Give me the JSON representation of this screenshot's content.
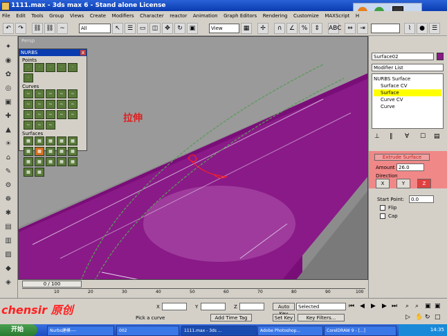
{
  "window": {
    "title": "1111.max - 3ds max 6 - Stand alone License"
  },
  "menu": [
    "File",
    "Edit",
    "Tools",
    "Group",
    "Views",
    "Create",
    "Modifiers",
    "Character",
    "reactor",
    "Animation",
    "Graph Editors",
    "Rendering",
    "Customize",
    "MAXScript",
    "H"
  ],
  "toolbar": {
    "selection_filter": "All",
    "ref_coord": "View"
  },
  "viewport": {
    "label": "Persp",
    "annotation": "拉伸"
  },
  "nurbs_panel": {
    "title": "NURBS",
    "points_label": "Points",
    "curves_label": "Curves",
    "surfaces_label": "Surfaces",
    "close": "x"
  },
  "command_panel": {
    "object_name": "Surface02",
    "modifier_list": "Modifier List",
    "stack": [
      "NURBS Surface",
      "Surface CV",
      "Surface",
      "Curve CV",
      "Curve"
    ],
    "rollout_title": "Extrude Surface",
    "amount_label": "Amount",
    "amount_value": "26.0",
    "direction_label": "Direction",
    "dir_x": "X",
    "dir_y": "Y",
    "dir_z": "Z",
    "start_point_label": "Start Point:",
    "start_point_value": "0.0",
    "flip_label": "Flip",
    "cap_label": "Cap"
  },
  "timeline": {
    "frame_display": "0 / 100",
    "ticks": [
      "10",
      "20",
      "30",
      "40",
      "50",
      "60",
      "70",
      "80",
      "90",
      "100"
    ]
  },
  "status": {
    "x_label": "X",
    "y_label": "Y",
    "z_label": "Z",
    "auto_key": "Auto Key",
    "set_key": "Set Key",
    "selected": "Selected",
    "key_filters": "Key Filters...",
    "prompt": "Pick a curve",
    "add_time_tag": "Add Time Tag",
    "watermark": "chensir 原创"
  },
  "taskbar": {
    "start": "开始",
    "items": [
      "Nurbs建模----",
      "002",
      "1111.max - 3ds ...",
      "Adobe Photoshop...",
      "CorelDRAW 9 - [...]"
    ],
    "clock": "14:35"
  }
}
